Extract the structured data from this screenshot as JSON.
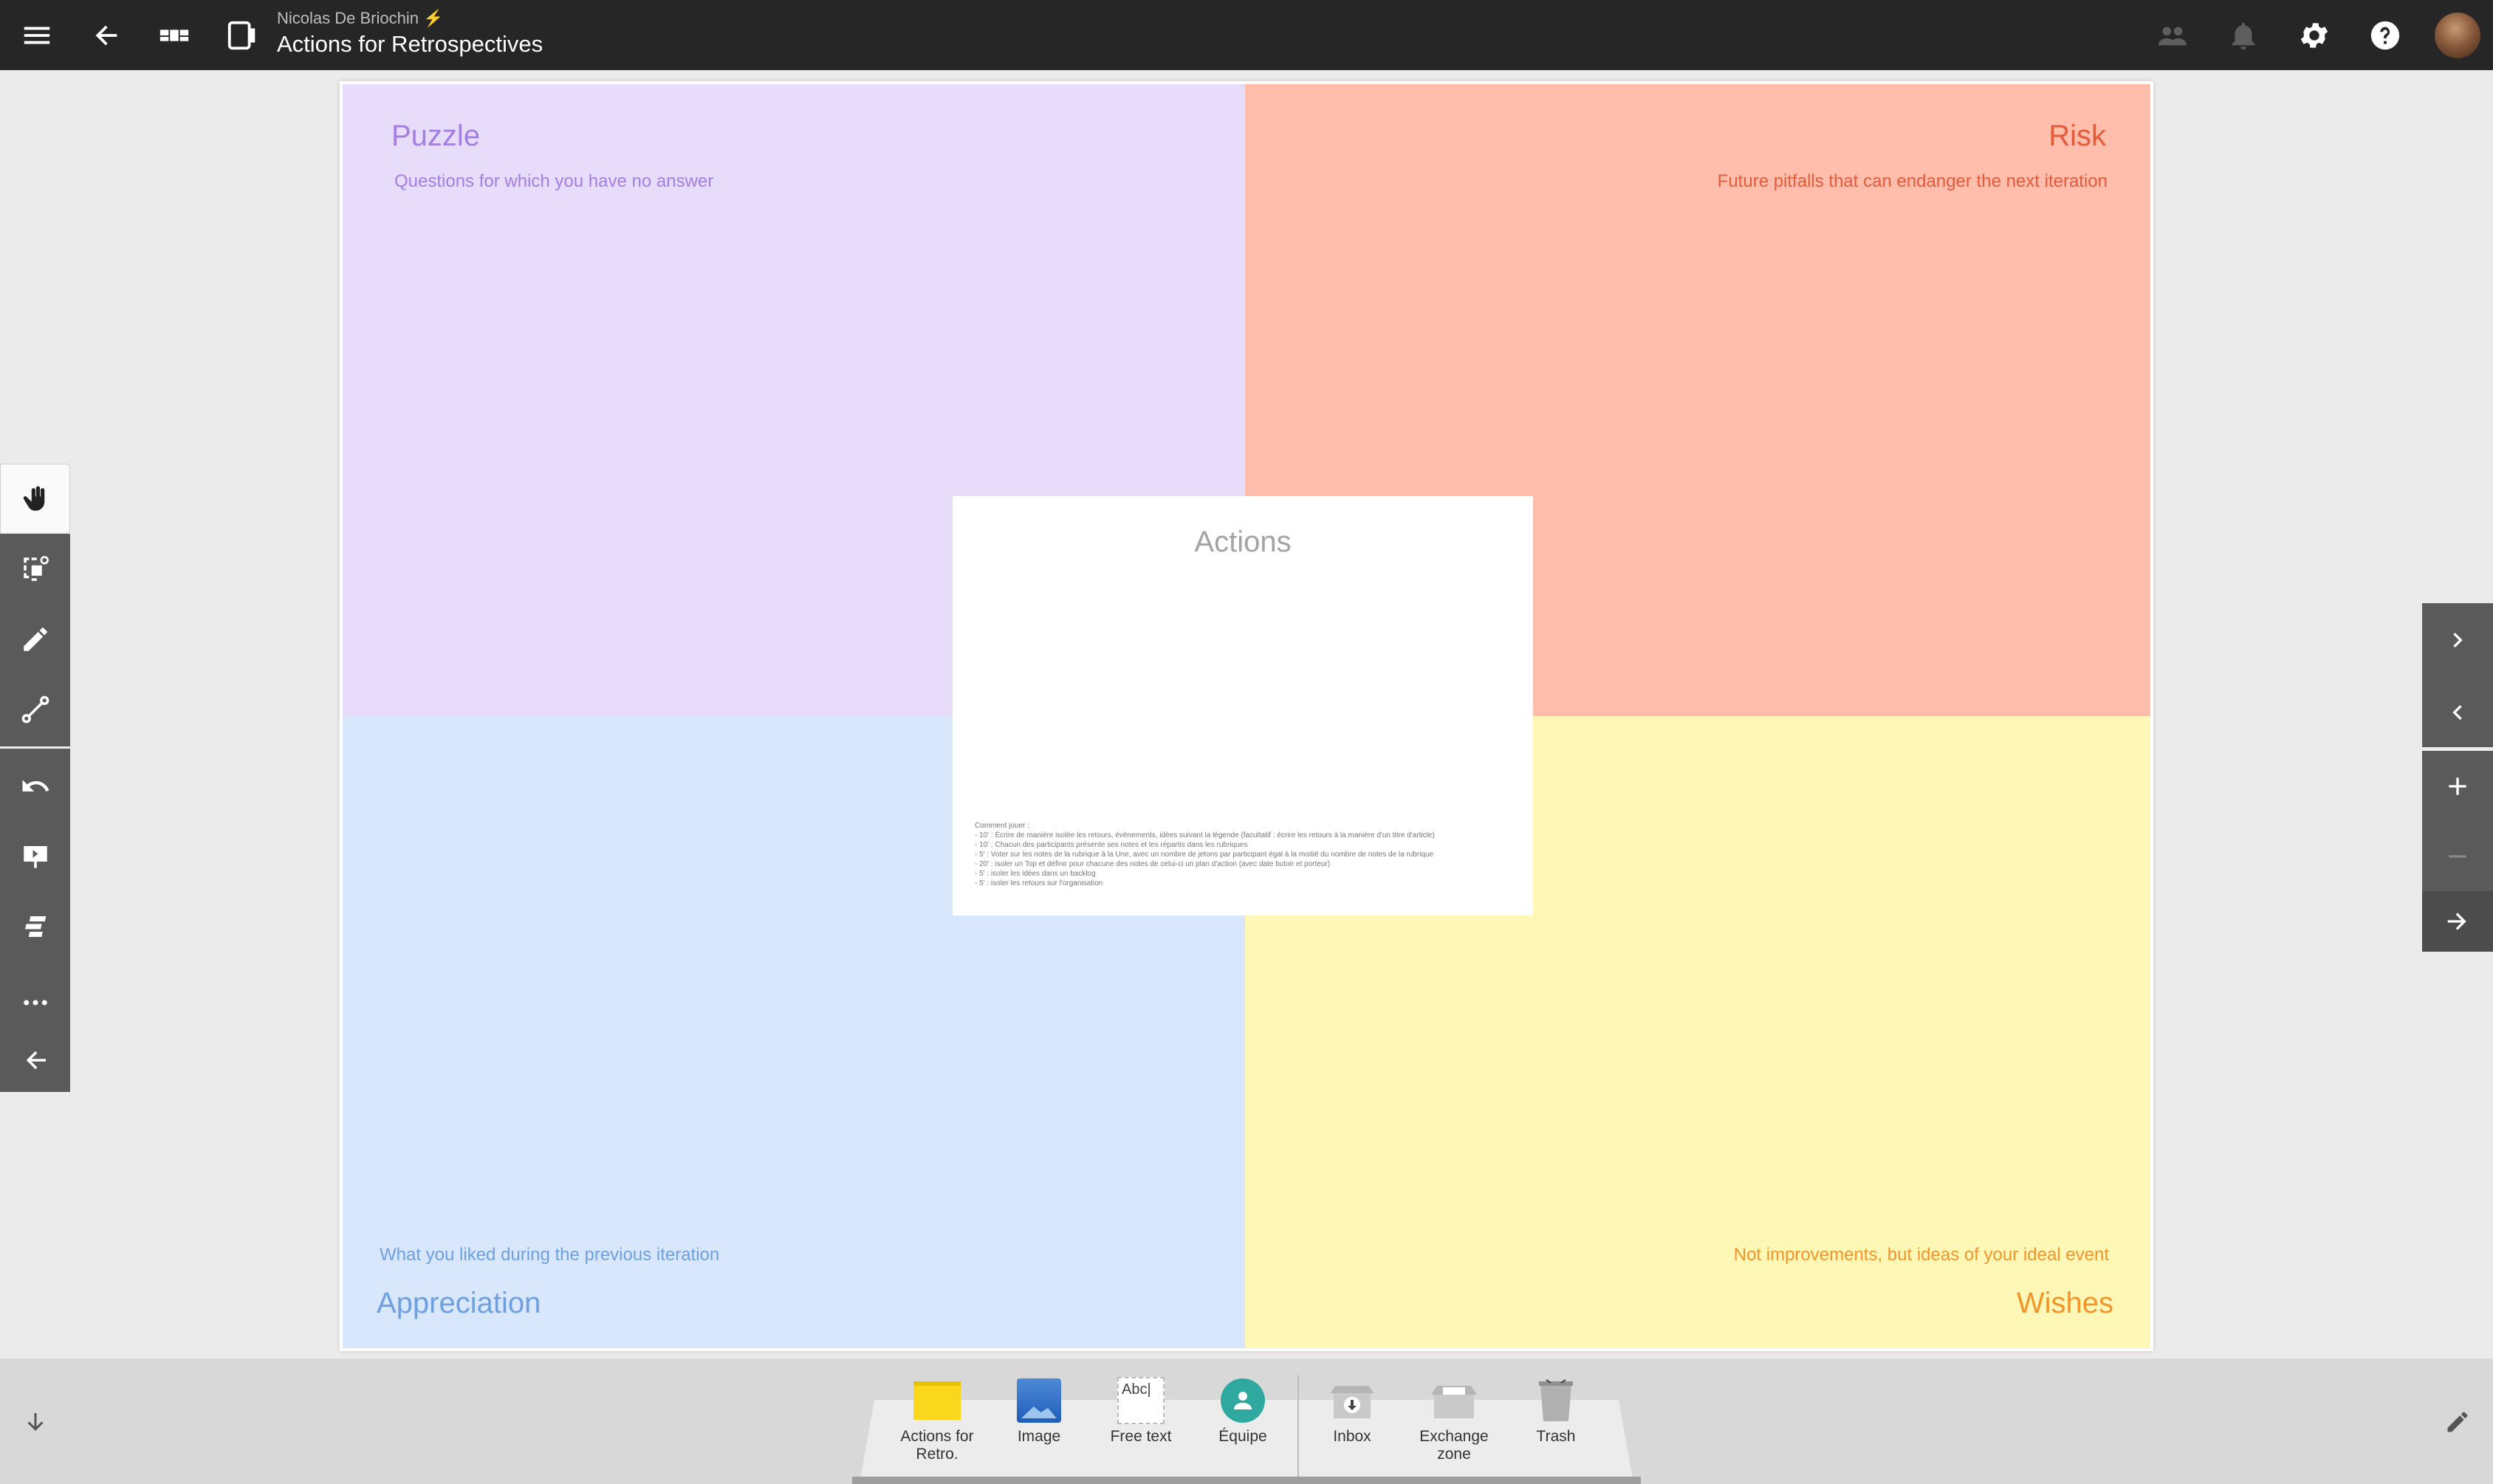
{
  "header": {
    "owner": "Nicolas De Briochin",
    "owner_badge": "⚡",
    "title": "Actions for Retrospectives"
  },
  "board": {
    "quadrants": {
      "puzzle": {
        "title": "Puzzle",
        "subtitle": "Questions for which you have no answer",
        "color": "#e8dcfb",
        "text_color": "#a47fe3"
      },
      "risk": {
        "title": "Risk",
        "subtitle": "Future pitfalls that can endanger the next iteration",
        "color": "#ffbeab",
        "text_color": "#e55a3b"
      },
      "appreciation": {
        "title": "Appreciation",
        "subtitle": "What you liked during the previous iteration",
        "color": "#d9e7fd",
        "text_color": "#6ea0e0"
      },
      "wishes": {
        "title": "Wishes",
        "subtitle": "Not improvements, but ideas of your ideal event",
        "color": "#fff7b6",
        "text_color": "#f2952b"
      }
    },
    "actions": {
      "title": "Actions",
      "howto": [
        "Comment jouer :",
        "- 10' : Écrire de manière isolée les retours, évènements, idées suivant la légende (facultatif : écrire les retours à la manière d'un titre d'article)",
        "- 10' : Chacun des participants présente ses notes et les répartis dans les rubriques",
        "- 5' : Voter sur les notes de la rubrique à la Une, avec un nombre de jetons par participant égal à la moitié du nombre de notes de la rubrique",
        "- 20' : isoler un Top et définir pour chacune des notes de celui-ci un plan d'action (avec date butoir et porteur)",
        "- 5' : isoler les idées dans un backlog",
        "- 5' : isoler les retours sur l'organisation"
      ]
    }
  },
  "bottom_tray": {
    "items": [
      {
        "label": "Actions for Retro.",
        "icon": "sticky-note-icon"
      },
      {
        "label": "Image",
        "icon": "image-icon"
      },
      {
        "label": "Free text",
        "icon": "free-text-icon",
        "icon_text": "Abc|"
      },
      {
        "label": "Équipe",
        "icon": "team-icon"
      },
      {
        "label": "Inbox",
        "icon": "inbox-icon"
      },
      {
        "label": "Exchange zone",
        "icon": "exchange-zone-icon"
      },
      {
        "label": "Trash",
        "icon": "trash-icon"
      }
    ]
  },
  "colors": {
    "topbar": "#262626",
    "toolbar": "#5a5a5a",
    "bottombar": "#d8d8d8"
  }
}
